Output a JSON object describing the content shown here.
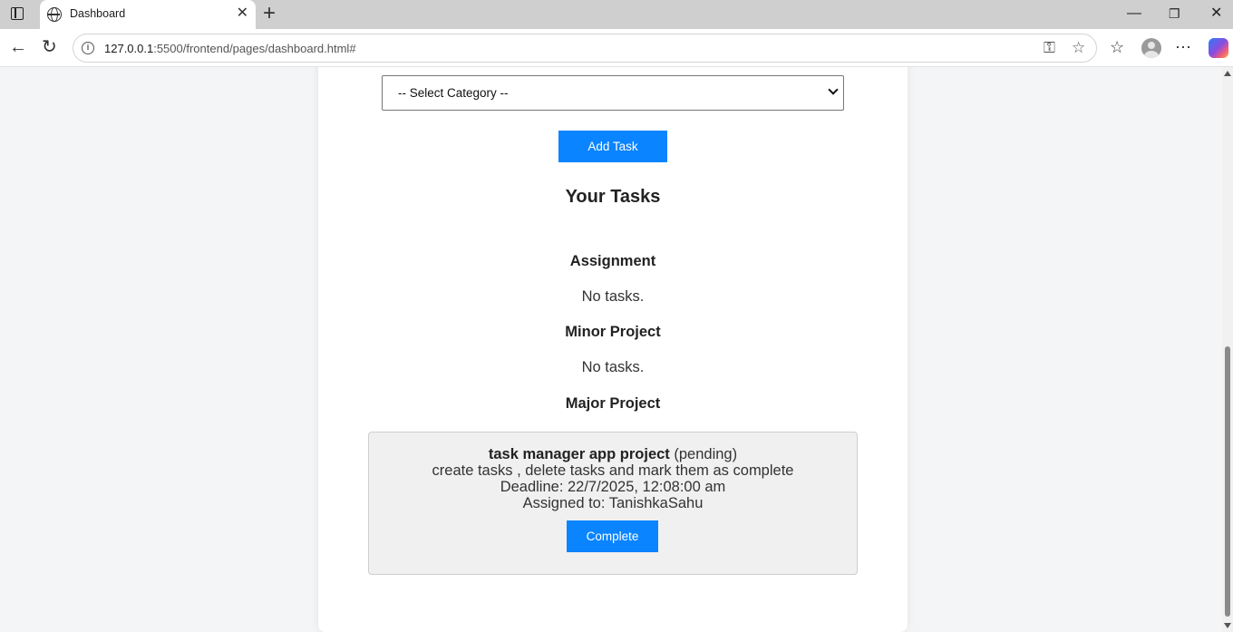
{
  "browser": {
    "tab_title": "Dashboard",
    "url_host": "127.0.0.1",
    "url_rest": ":5500/frontend/pages/dashboard.html#"
  },
  "form": {
    "category_placeholder": "-- Select Category --",
    "add_task_label": "Add Task"
  },
  "tasks": {
    "heading": "Your Tasks",
    "categories": [
      {
        "name": "Assignment",
        "empty_text": "No tasks."
      },
      {
        "name": "Minor Project",
        "empty_text": "No tasks."
      },
      {
        "name": "Major Project"
      }
    ],
    "items": [
      {
        "title": "task manager app project",
        "status": "(pending)",
        "description": "create tasks , delete tasks and mark them as complete",
        "deadline": "Deadline: 22/7/2025, 12:08:00 am",
        "assigned": "Assigned to: TanishkaSahu",
        "action_label": "Complete"
      }
    ]
  },
  "colors": {
    "accent": "#0a84ff",
    "task_card_bg": "#f0f0f0"
  }
}
